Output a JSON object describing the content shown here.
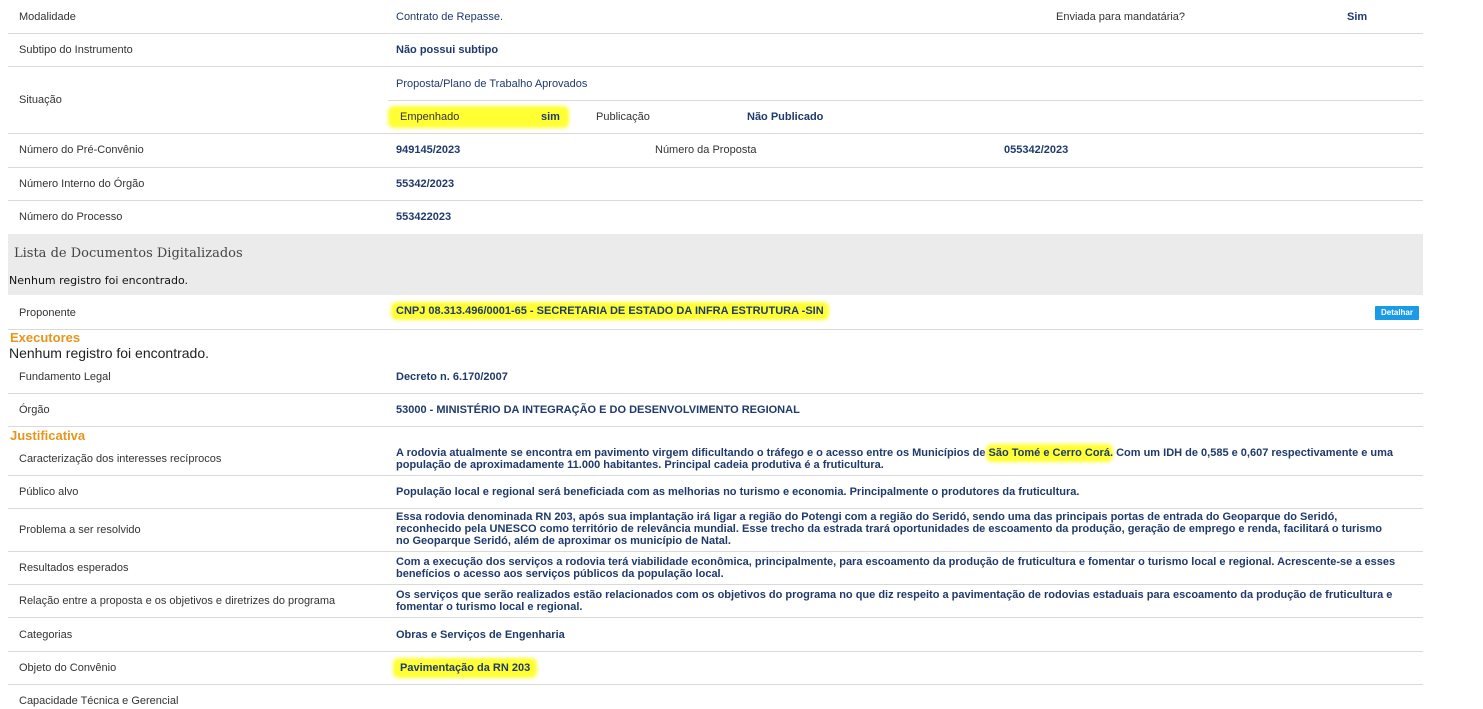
{
  "modalidade": {
    "label": "Modalidade",
    "value": "Contrato de Repasse.",
    "mandataria_label": "Enviada para mandatária?",
    "mandataria_value": "Sim"
  },
  "subtipo": {
    "label": "Subtipo do Instrumento",
    "value": "Não possui subtipo"
  },
  "situacao": {
    "label": "Situação",
    "value": "Proposta/Plano de Trabalho Aprovados",
    "empenhado_label": "Empenhado",
    "empenhado_value": "sim",
    "publicacao_label": "Publicação",
    "publicacao_value": "Não Publicado"
  },
  "pre_convenio": {
    "label": "Número do Pré-Convênio",
    "value": "949145/2023",
    "proposta_label": "Número da Proposta",
    "proposta_value": "055342/2023"
  },
  "interno": {
    "label": "Número Interno do Órgão",
    "value": "55342/2023"
  },
  "processo": {
    "label": "Número do Processo",
    "value": "553422023"
  },
  "documentos": {
    "title": "Lista de Documentos Digitalizados",
    "empty": "Nenhum registro foi encontrado."
  },
  "proponente": {
    "label": "Proponente",
    "value": "CNPJ 08.313.496/0001-65 - SECRETARIA DE ESTADO DA INFRA ESTRUTURA -SIN",
    "button": "Detalhar"
  },
  "executores": {
    "title": "Executores",
    "empty": "Nenhum registro foi encontrado."
  },
  "fundamento": {
    "label": "Fundamento Legal",
    "value": "Decreto n. 6.170/2007"
  },
  "orgao": {
    "label": "Órgão",
    "value": "53000 - MINISTÉRIO DA INTEGRAÇÃO E DO DESENVOLVIMENTO REGIONAL"
  },
  "justificativa": {
    "title": "Justificativa"
  },
  "caracterizacao": {
    "label": "Caracterização dos interesses recíprocos",
    "value_a": "A rodovia atualmente se encontra em pavimento virgem dificultando o tráfego e o acesso entre os Municípios de ",
    "value_hl": "São Tomé e Cerro Corá",
    "value_b": ". Com um IDH de 0,585 e 0,607 respectivamente e uma população de aproximadamente 11.000 habitantes. Principal cadeia produtiva é a fruticultura."
  },
  "publico": {
    "label": "Público alvo",
    "value": "População local e regional será beneficiada com as melhorias no turismo e economia. Principalmente o produtores da fruticultura."
  },
  "problema": {
    "label": "Problema a ser resolvido",
    "value": "Essa rodovia denominada RN 203, após sua implantação irá ligar a região do Potengi com a região do Seridó, sendo uma das principais portas de entrada do Geoparque do Seridó, reconhecido pela UNESCO como território de relevância mundial. Esse trecho da estrada trará oportunidades de escoamento da produção, geração de emprego e renda, facilitará o turismo no Geoparque Seridó, além de aproximar os município de Natal."
  },
  "resultados": {
    "label": "Resultados esperados",
    "value": "Com a execução dos serviços a rodovia terá viabilidade econômica, principalmente, para escoamento da produção de fruticultura e fomentar o turismo local e regional. Acrescente-se a esses benefícios o acesso aos serviços públicos da população local."
  },
  "relacao": {
    "label": "Relação entre a proposta e os objetivos e diretrizes do programa",
    "value": "Os serviços que serão realizados estão relacionados com os objetivos do programa no que diz respeito a pavimentação de rodovias estaduais para escoamento da produção de fruticultura e fomentar o turismo local e regional."
  },
  "categorias": {
    "label": "Categorias",
    "value": "Obras e Serviços de Engenharia"
  },
  "objeto": {
    "label": "Objeto do Convênio",
    "value": "Pavimentação da RN 203"
  },
  "capacidade": {
    "label": "Capacidade Técnica e Gerencial"
  },
  "colors": {
    "highlight": "#ffff33",
    "section_title": "#e8951c",
    "value_text": "#1f3a6b",
    "button": "#1a9be8"
  }
}
